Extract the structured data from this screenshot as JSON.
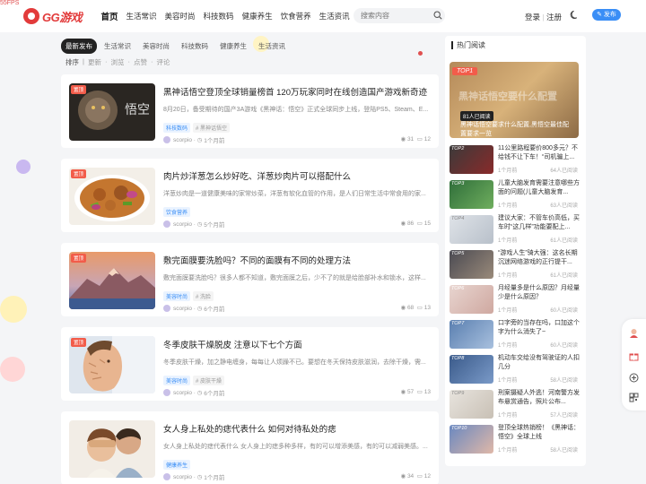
{
  "fps": "55FPS",
  "header": {
    "logo_text": "GG游戏",
    "nav": [
      "首页",
      "生活常识",
      "美容时尚",
      "科技数码",
      "健康养生",
      "饮食营养",
      "生活资讯"
    ],
    "search_placeholder": "搜索内容",
    "login": "登录",
    "register": "注册",
    "publish": "发布"
  },
  "tabs": [
    "最新发布",
    "生活常识",
    "美容时尚",
    "科技数码",
    "健康养生",
    "生活资讯"
  ],
  "sort": {
    "label": "排序",
    "options": [
      "更新",
      "浏览",
      "点赞",
      "评论"
    ]
  },
  "articles": [
    {
      "badge": "置顶",
      "title": "黑神话悟空登顶全球销量榜首 120万玩家同时在线创造国产游戏新奇迹",
      "excerpt": "8月20日，备受期待的国产3A游戏《黑神话：悟空》正式全球同步上线，登陆PS5、Steam、E...",
      "tags": [
        "科技数码",
        "# 黑神话悟空"
      ],
      "author": "scorpio",
      "time": "1个月前",
      "views": "31",
      "comments": "12"
    },
    {
      "badge": "置顶",
      "title": "肉片炒洋葱怎么炒好吃、洋葱炒肉片可以搭配什么",
      "excerpt": "洋葱炒肉是一道健康美味的家常炒菜，洋葱有软化血管的作用，是人们日常生活中常食用的家...",
      "tags": [
        "饮食营养"
      ],
      "author": "scorpio",
      "time": "5个月前",
      "views": "86",
      "comments": "15"
    },
    {
      "badge": "置顶",
      "title": "敷完面膜要洗脸吗？不同的面膜有不同的处理方法",
      "excerpt": "敷完面膜要洗脸吗？很多人都不知道，敷完面膜之后，少不了的就是给脸部补水和锁水，这样...",
      "tags": [
        "美容时尚",
        "# 洗脸"
      ],
      "author": "scorpio",
      "time": "6个月前",
      "views": "68",
      "comments": "13"
    },
    {
      "badge": "置顶",
      "title": "冬季皮肤干燥脱皮 注意以下七个方面",
      "excerpt": "冬季皮肤干燥，加之静电缠身，每每让人烦躁不已。要想在冬天保持皮肤滋润，去除干燥，需...",
      "tags": [
        "美容时尚",
        "# 皮肤干燥"
      ],
      "author": "scorpio",
      "time": "6个月前",
      "views": "57",
      "comments": "13"
    },
    {
      "badge": "",
      "title": "女人身上私处的痣代表什么 如何对待私处的痣",
      "excerpt": "女人身上私处的痣代表什么 女人身上的痣多种多样，有的可以增添美感，有的可以减弱美感。...",
      "tags": [
        "健康养生"
      ],
      "author": "scorpio",
      "time": "1个月前",
      "views": "34",
      "comments": "12"
    }
  ],
  "sidebar": {
    "title": "热门阅读",
    "hero": {
      "badge": "TOP1",
      "views": "81人已阅读",
      "title": "黑神话悟空要求什么配置,黑悟空最佳配置要求一览",
      "overlay": "黑神话悟空要什么配置"
    },
    "items": [
      {
        "badge": "TOP2",
        "title": "11公里路程要价800多元？不给钱不让下车！“司机骗上...",
        "time": "1个月前",
        "reads": "64人已阅读"
      },
      {
        "badge": "TOP3",
        "title": "儿童大脑发育需要注意哪些方面的问题(儿童大脑发育...",
        "time": "1个月前",
        "reads": "63人已阅读"
      },
      {
        "badge": "TOP4",
        "title": "建议大家：不管车价高低，买车时“这几样”功能要配上...",
        "time": "1个月前",
        "reads": "61人已阅读"
      },
      {
        "badge": "TOP5",
        "title": "“游戏人生”骑大强：这名长期沉迷网络游戏的正行提干...",
        "time": "1个月前",
        "reads": "61人已阅读"
      },
      {
        "badge": "TOP6",
        "title": "月经量多是什么原因？月经量少是什么原因？",
        "time": "1个月前",
        "reads": "60人已阅读"
      },
      {
        "badge": "TOP7",
        "title": "口字旁的当存在吗，口加这个字为什么消失了~",
        "time": "1个月前",
        "reads": "60人已阅读"
      },
      {
        "badge": "TOP8",
        "title": "机动车交给没有驾驶证的人扣几分",
        "time": "1个月前",
        "reads": "58人已阅读"
      },
      {
        "badge": "TOP9",
        "title": "刑案摄疑人外逃！河南警方发布悬赏通告，照片公布...",
        "time": "1个月前",
        "reads": "57人已阅读"
      },
      {
        "badge": "TOP10",
        "title": "登顶全球热销榜！《黑神话：悟空》全球上线",
        "time": "1个月前",
        "reads": "58人已阅读"
      }
    ]
  }
}
